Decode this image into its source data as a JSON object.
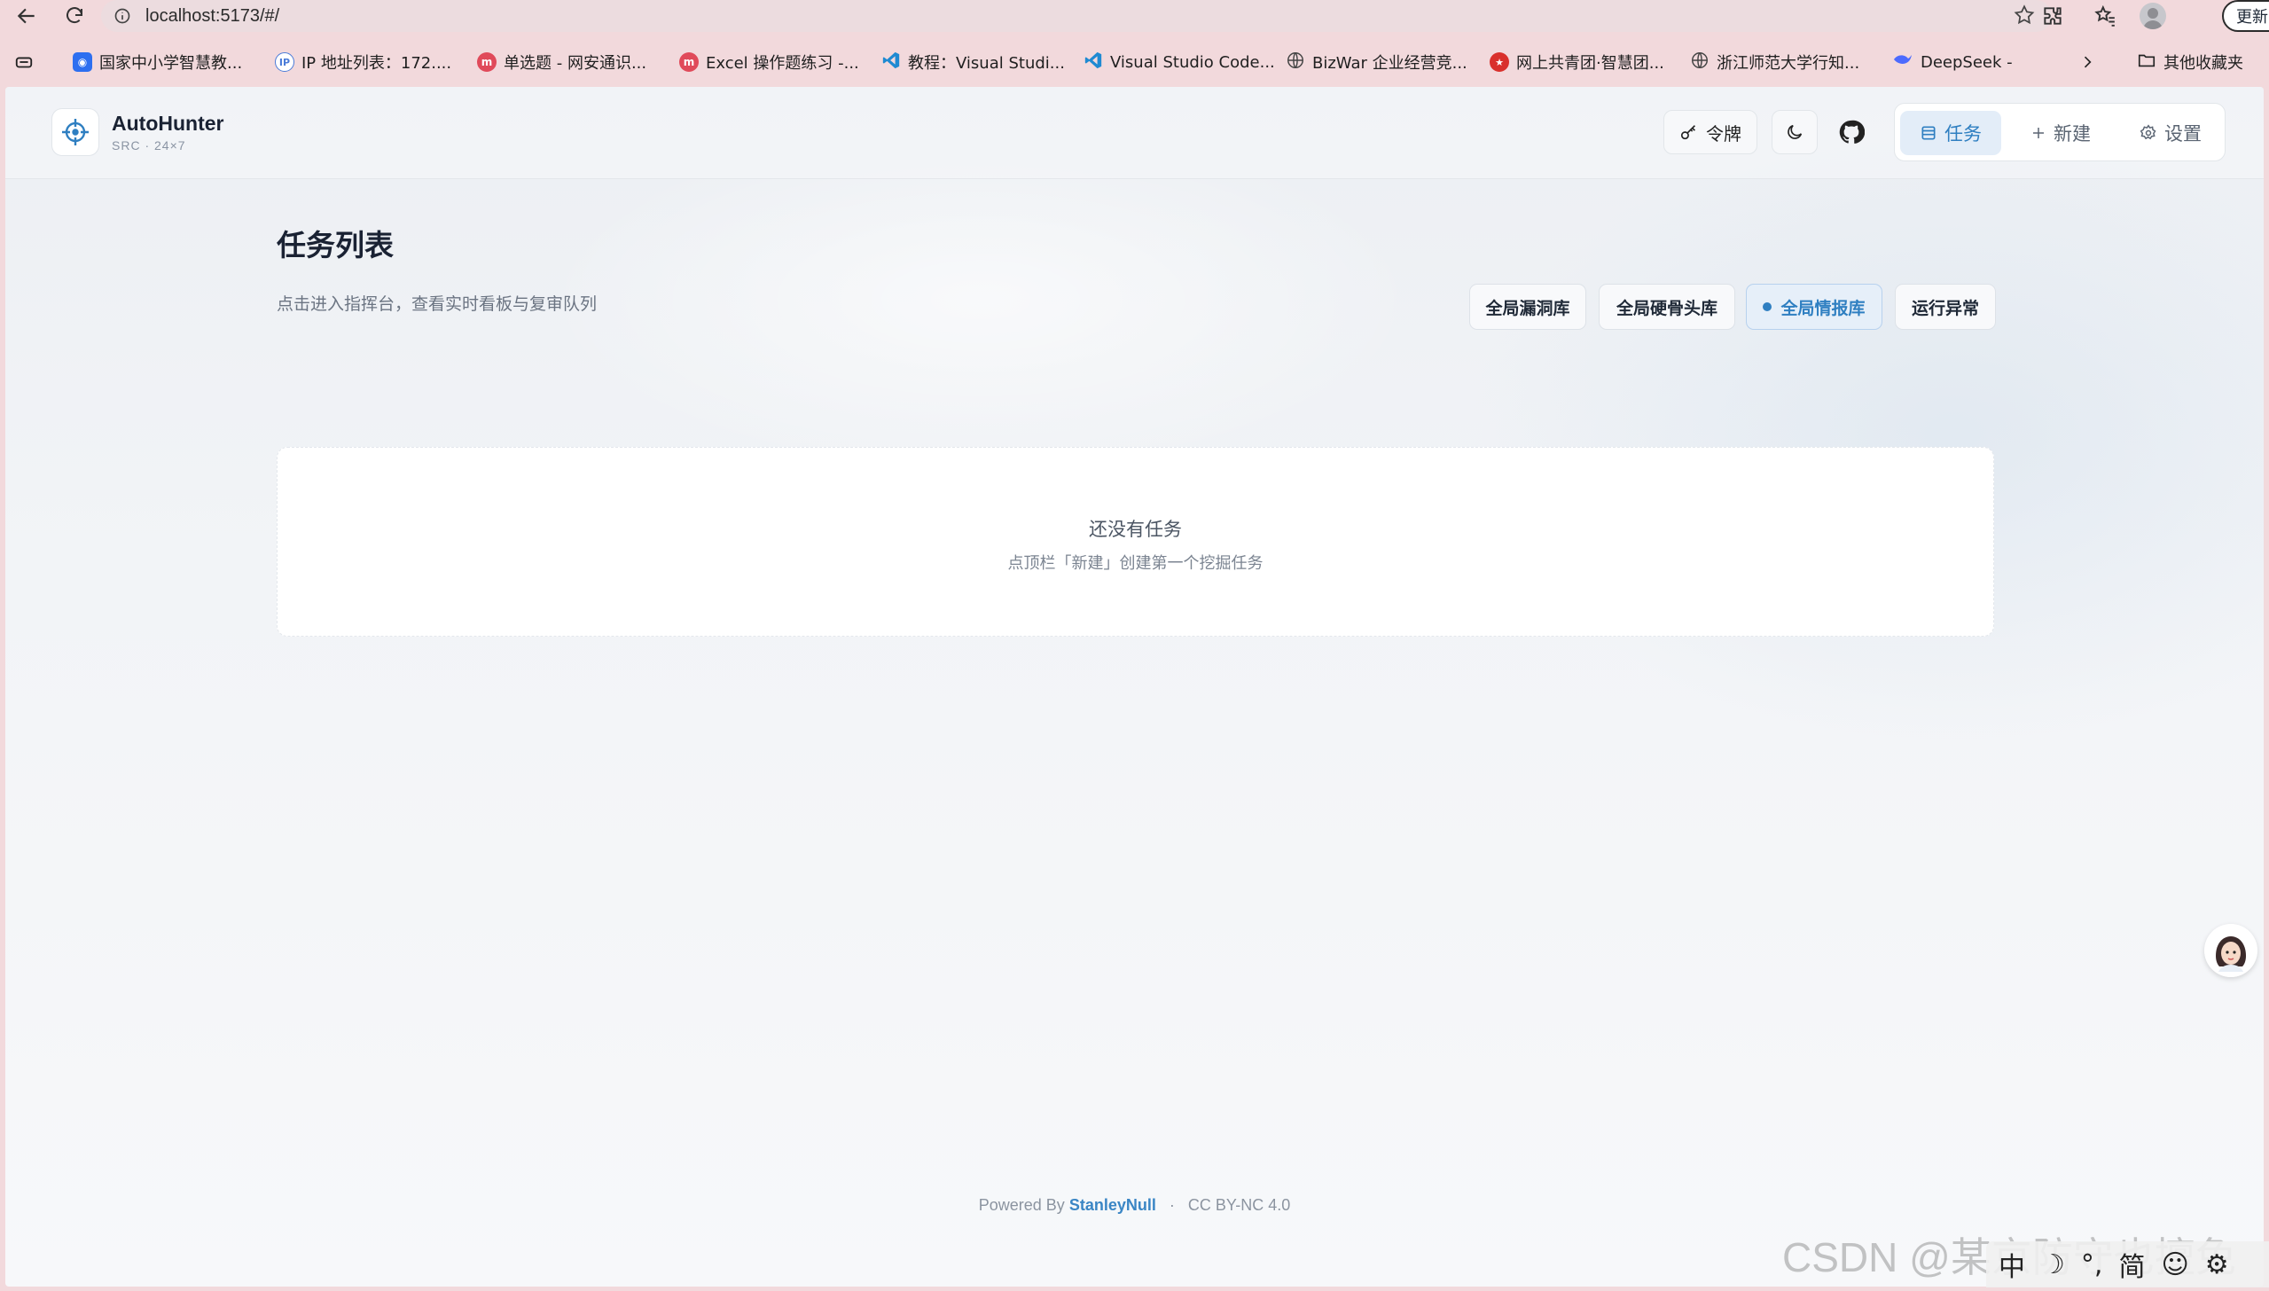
{
  "browser": {
    "url": "localhost:5173/#/",
    "update_label": "更新 ⋯",
    "bookmarks": [
      {
        "label": "国家中小学智慧教...",
        "icon": "smartedu-icon",
        "color": "#2d6ff0"
      },
      {
        "label": "IP 地址列表：172....",
        "icon": "ip-icon",
        "color": "#4a7bd8"
      },
      {
        "label": "单选题 - 网安通识...",
        "icon": "course-icon",
        "color": "#e04a5a"
      },
      {
        "label": "Excel 操作题练习 -...",
        "icon": "course-icon",
        "color": "#e04a5a"
      },
      {
        "label": "教程：Visual Studi...",
        "icon": "vscode-icon",
        "color": "#1f8ad2"
      },
      {
        "label": "Visual Studio Code...",
        "icon": "vscode-icon",
        "color": "#1f8ad2"
      },
      {
        "label": "BizWar 企业经营竞...",
        "icon": "globe-icon",
        "color": "#444444"
      },
      {
        "label": "网上共青团·智慧团...",
        "icon": "league-icon",
        "color": "#d9302c"
      },
      {
        "label": "浙江师范大学行知...",
        "icon": "globe-icon",
        "color": "#444444"
      },
      {
        "label": "DeepSeek -",
        "icon": "deepseek-icon",
        "color": "#4d6bfe"
      }
    ],
    "other_bookmarks_label": "其他收藏夹"
  },
  "header": {
    "brand_name": "AutoHunter",
    "brand_sub": "SRC · 24×7",
    "token_label": "令牌",
    "nav": {
      "tasks": "任务",
      "new": "新建",
      "settings": "设置"
    }
  },
  "main": {
    "title": "任务列表",
    "subtitle": "点击进入指挥台，查看实时看板与复审队列",
    "filters": [
      "全局漏洞库",
      "全局硬骨头库",
      "全局情报库",
      "运行异常"
    ],
    "active_filter": "全局情报库",
    "empty_title": "还没有任务",
    "empty_hint": "点顶栏「新建」创建第一个挖掘任务"
  },
  "footer": {
    "powered_by": "Powered By",
    "author": "StanleyNull",
    "separator": "·",
    "license": "CC BY-NC 4.0"
  },
  "watermark": "CSDN @某京防守也擅免",
  "ime": {
    "lang": "中",
    "mode": "简"
  },
  "colors": {
    "accent": "#2f7fc1",
    "brand": "#1a2233"
  }
}
